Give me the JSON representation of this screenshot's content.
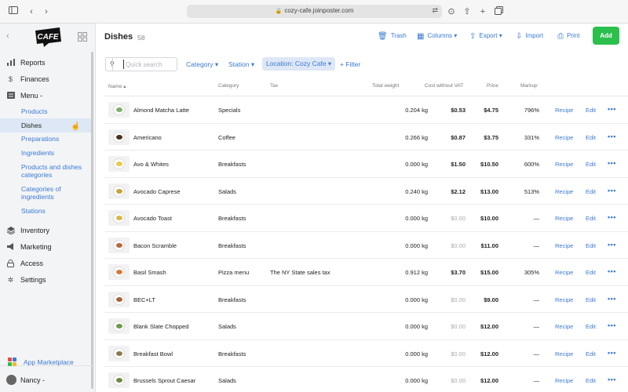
{
  "browser": {
    "url": "cozy-cafe.joinposter.com"
  },
  "sidebar": {
    "logo_text": "CAFE",
    "items": [
      {
        "label": "Reports",
        "icon": "bar-chart-icon"
      },
      {
        "label": "Finances",
        "icon": "dollar-icon"
      },
      {
        "label": "Menu -",
        "icon": "menu-book-icon"
      },
      {
        "label": "Inventory",
        "icon": "layers-icon"
      },
      {
        "label": "Marketing",
        "icon": "megaphone-icon"
      },
      {
        "label": "Access",
        "icon": "lock-icon"
      },
      {
        "label": "Settings",
        "icon": "gear-icon"
      }
    ],
    "menu_sub": [
      "Products",
      "Dishes",
      "Preparations",
      "Ingredients",
      "Products and dishes",
      "categories",
      "Categories of",
      "ingredients",
      "Stations"
    ],
    "app_marketplace": "App Marketplace",
    "user": "Nancy -"
  },
  "header": {
    "title": "Dishes",
    "count": "58",
    "trash": "Trash",
    "columns": "Columns",
    "export": "Export",
    "import": "Import",
    "print": "Print",
    "add": "Add"
  },
  "filters": {
    "search_placeholder": "Quick search",
    "category": "Category",
    "station": "Station",
    "location": "Location: Cozy Cafe",
    "add_filter": "+ Filter"
  },
  "table": {
    "columns": [
      "Name",
      "Category",
      "Tax",
      "Total weight",
      "Cost without VAT",
      "Price",
      "Markup"
    ],
    "rows": [
      {
        "name": "Almond Matcha Latte",
        "category": "Specials",
        "tax": "",
        "weight": "0.204 kg",
        "cost": "$0.53",
        "price": "$4.75",
        "markup": "796%",
        "food_color": "#7fb069"
      },
      {
        "name": "Americano",
        "category": "Coffee",
        "tax": "",
        "weight": "0.266 kg",
        "cost": "$0.87",
        "price": "$3.75",
        "markup": "331%",
        "food_color": "#4a2f1c"
      },
      {
        "name": "Avo & Whites",
        "category": "Breakfasts",
        "tax": "",
        "weight": "0.000 kg",
        "cost": "$1.50",
        "price": "$10.50",
        "markup": "600%",
        "food_color": "#e8c94a"
      },
      {
        "name": "Avocado Caprese",
        "category": "Salads",
        "tax": "",
        "weight": "0.240 kg",
        "cost": "$2.12",
        "price": "$13.00",
        "markup": "513%",
        "food_color": "#c9a23a"
      },
      {
        "name": "Avocado Toast",
        "category": "Breakfasts",
        "tax": "",
        "weight": "0.000 kg",
        "cost": "$0.00",
        "price": "$10.00",
        "markup": "—",
        "food_color": "#d9b64a"
      },
      {
        "name": "Bacon Scramble",
        "category": "Breakfasts",
        "tax": "",
        "weight": "0.000 kg",
        "cost": "$0.00",
        "price": "$11.00",
        "markup": "—",
        "food_color": "#b9683a"
      },
      {
        "name": "Basil Smash",
        "category": "Pizza menu",
        "tax": "The NY State sales tax",
        "weight": "0.912 kg",
        "cost": "$3.70",
        "price": "$15.00",
        "markup": "305%",
        "food_color": "#d77a3a"
      },
      {
        "name": "BEC+LT",
        "category": "Breakfasts",
        "tax": "",
        "weight": "0.000 kg",
        "cost": "$0.00",
        "price": "$9.00",
        "markup": "—",
        "food_color": "#a8643b"
      },
      {
        "name": "Blank Slate Chopped",
        "category": "Salads",
        "tax": "",
        "weight": "0.000 kg",
        "cost": "$0.00",
        "price": "$12.00",
        "markup": "—",
        "food_color": "#6f9a4a"
      },
      {
        "name": "Breakfast Bowl",
        "category": "Breakfasts",
        "tax": "",
        "weight": "0.000 kg",
        "cost": "$0.00",
        "price": "$12.00",
        "markup": "—",
        "food_color": "#8a7a4a"
      },
      {
        "name": "Brussels Sprout Caesar",
        "category": "Salads",
        "tax": "",
        "weight": "0.000 kg",
        "cost": "$0.00",
        "price": "$12.00",
        "markup": "—",
        "food_color": "#6c8a3f"
      }
    ],
    "recipe": "Recipe",
    "edit": "Edit",
    "more": "•••"
  }
}
